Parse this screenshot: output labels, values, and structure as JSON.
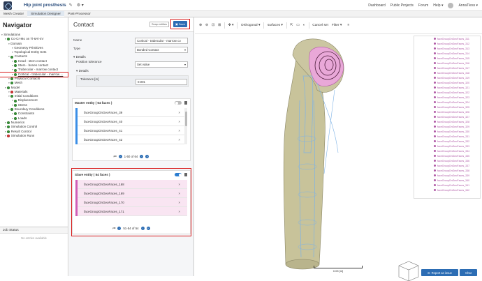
{
  "header": {
    "project_title": "Hip joint prosthesis",
    "nav": [
      "Dashboard",
      "Public Projects",
      "Forum",
      "Help ▾",
      "AnnaTless ▾"
    ]
  },
  "tabs": [
    "Mesh Creator",
    "Simulation Designer",
    "Post-Processor"
  ],
  "navigator": {
    "title": "Navigator",
    "tree": [
      {
        "label": "Simulations",
        "level": 0,
        "dot": "none"
      },
      {
        "label": "Co-Cr-Mo on Ti-6Al-4V",
        "level": 1,
        "dot": "green"
      },
      {
        "label": "Domain",
        "level": 2,
        "dot": "none"
      },
      {
        "label": "Geometry Primitives",
        "level": 3,
        "dot": "none"
      },
      {
        "label": "Topological Entity Sets",
        "level": 3,
        "dot": "none"
      },
      {
        "label": "Contacts",
        "level": 2,
        "dot": "green"
      },
      {
        "label": "Head - stem contact",
        "level": 3,
        "dot": "green"
      },
      {
        "label": "Stem - bones contact",
        "level": 3,
        "dot": "green"
      },
      {
        "label": "Trabecular - marrow contact",
        "level": 3,
        "dot": "green"
      },
      {
        "label": "Cortical - trabecular - marrow ...",
        "level": 3,
        "dot": "green",
        "selected": true
      },
      {
        "label": "Physical Contacts",
        "level": 2,
        "dot": "green"
      },
      {
        "label": "Mesh",
        "level": 2,
        "dot": "green"
      },
      {
        "label": "Model",
        "level": 1,
        "dot": "green"
      },
      {
        "label": "Materials",
        "level": 2,
        "dot": "red"
      },
      {
        "label": "Initial Conditions",
        "level": 2,
        "dot": "green"
      },
      {
        "label": "Displacement",
        "level": 3,
        "dot": "green"
      },
      {
        "label": "Stress",
        "level": 3,
        "dot": "green"
      },
      {
        "label": "Boundary Conditions",
        "level": 2,
        "dot": "green"
      },
      {
        "label": "Constraints",
        "level": 3,
        "dot": "green"
      },
      {
        "label": "Loads",
        "level": 3,
        "dot": "green"
      },
      {
        "label": "Numerics",
        "level": 1,
        "dot": "green"
      },
      {
        "label": "Simulation Control",
        "level": 1,
        "dot": "green"
      },
      {
        "label": "Result Control",
        "level": 1,
        "dot": "green"
      },
      {
        "label": "Simulation Runs",
        "level": 1,
        "dot": "red"
      }
    ]
  },
  "job_status": {
    "title": "Job Status",
    "empty": "No entries available"
  },
  "contact": {
    "title": "Contact",
    "snap_label": "Snap entities",
    "save_label": "Save",
    "name_label": "Name",
    "name_value": "Cortical - trabecular - marrow co",
    "type_label": "Type",
    "type_value": "Bonded Contact",
    "details_label": "▾ Details",
    "position_tolerance_label": "Position tolerance",
    "position_tolerance_value": "Set value",
    "details_sub_label": "▾ Details",
    "tolerance_label": "Tolerance [m]",
    "tolerance_value": "0.001",
    "master": {
      "header": "Master entity  ( 64 faces )",
      "items": [
        "faceGroupOnGeoFaces_39",
        "faceGroupOnGeoFaces_40",
        "faceGroupOnGeoFaces_41",
        "faceGroupOnGeoFaces_42"
      ],
      "pager": "1-50 of 64",
      "toggle_on": false
    },
    "slave": {
      "header": "Slave entity  ( 54 faces )",
      "items": [
        "faceGroupOnGeoFaces_168",
        "faceGroupOnGeoFaces_169",
        "faceGroupOnGeoFaces_170",
        "faceGroupOnGeoFaces_171"
      ],
      "pager": "51-54 of 54",
      "toggle_on": true
    }
  },
  "viewport": {
    "toolbar": {
      "projection": "Orthogonal ▾",
      "render_mode": "surfaces ▾",
      "cancel_set": "Cancel set",
      "filter": "Filter ▾"
    },
    "list_items": [
      "faceGroupOnGeoFaces_311",
      "faceGroupOnGeoFaces_312",
      "faceGroupOnGeoFaces_313",
      "faceGroupOnGeoFaces_314",
      "faceGroupOnGeoFaces_315",
      "faceGroupOnGeoFaces_316",
      "faceGroupOnGeoFaces_317",
      "faceGroupOnGeoFaces_318",
      "faceGroupOnGeoFaces_319",
      "faceGroupOnGeoFaces_320",
      "faceGroupOnGeoFaces_321",
      "faceGroupOnGeoFaces_322",
      "faceGroupOnGeoFaces_323",
      "faceGroupOnGeoFaces_324",
      "faceGroupOnGeoFaces_325",
      "faceGroupOnGeoFaces_326",
      "faceGroupOnGeoFaces_327",
      "faceGroupOnGeoFaces_328",
      "faceGroupOnGeoFaces_329",
      "faceGroupOnGeoFaces_330",
      "faceGroupOnGeoFaces_331",
      "faceGroupOnGeoFaces_332",
      "faceGroupOnGeoFaces_333",
      "faceGroupOnGeoFaces_334",
      "faceGroupOnGeoFaces_335",
      "faceGroupOnGeoFaces_336",
      "faceGroupOnGeoFaces_337",
      "faceGroupOnGeoFaces_338",
      "faceGroupOnGeoFaces_339",
      "faceGroupOnGeoFaces_340",
      "faceGroupOnGeoFaces_341",
      "faceGroupOnGeoFaces_342"
    ],
    "scale_label": "0.05 [m]",
    "report_label": "Report an issue",
    "chat_label": "Chat"
  },
  "colors": {
    "accent": "#2c6db4",
    "highlight": "#d81c1c",
    "slave": "#cf5fb7",
    "master": "#3a8ee6",
    "bone": "#c8c39a"
  }
}
